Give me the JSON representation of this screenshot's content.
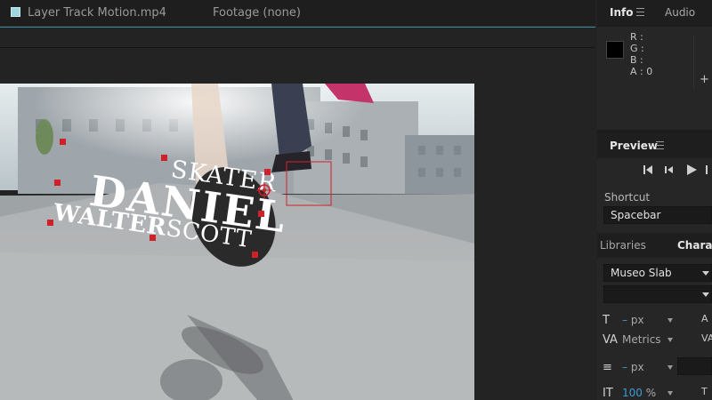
{
  "tabs": {
    "composition": "Layer Track Motion.mp4",
    "footage": "Footage (none)"
  },
  "info_panel": {
    "tab_info": "Info",
    "tab_audio": "Audio",
    "r": "R :",
    "g": "G :",
    "b": "B :",
    "a": "A : 0",
    "plus": "+"
  },
  "preview_panel": {
    "title": "Preview",
    "shortcut_label": "Shortcut",
    "shortcut_value": "Spacebar"
  },
  "character_panel": {
    "tab_libraries": "Libraries",
    "tab_character": "Characte",
    "font_family": "Museo Slab",
    "font_style": "",
    "size_value": "–",
    "size_unit": "px",
    "kerning": "Metrics",
    "stroke_value": "–",
    "stroke_unit": "px",
    "scale_value": "100",
    "scale_unit": "%"
  },
  "viewer_text": {
    "line1": "SKATER",
    "line2": "DANIEL",
    "line3_bold": "WALTER",
    "line3_light": "SCOTT"
  },
  "colors": {
    "accent_blue": "#3d9bd6",
    "tracker_red": "#d0202a",
    "tab_highlight": "#3d8aa0"
  }
}
